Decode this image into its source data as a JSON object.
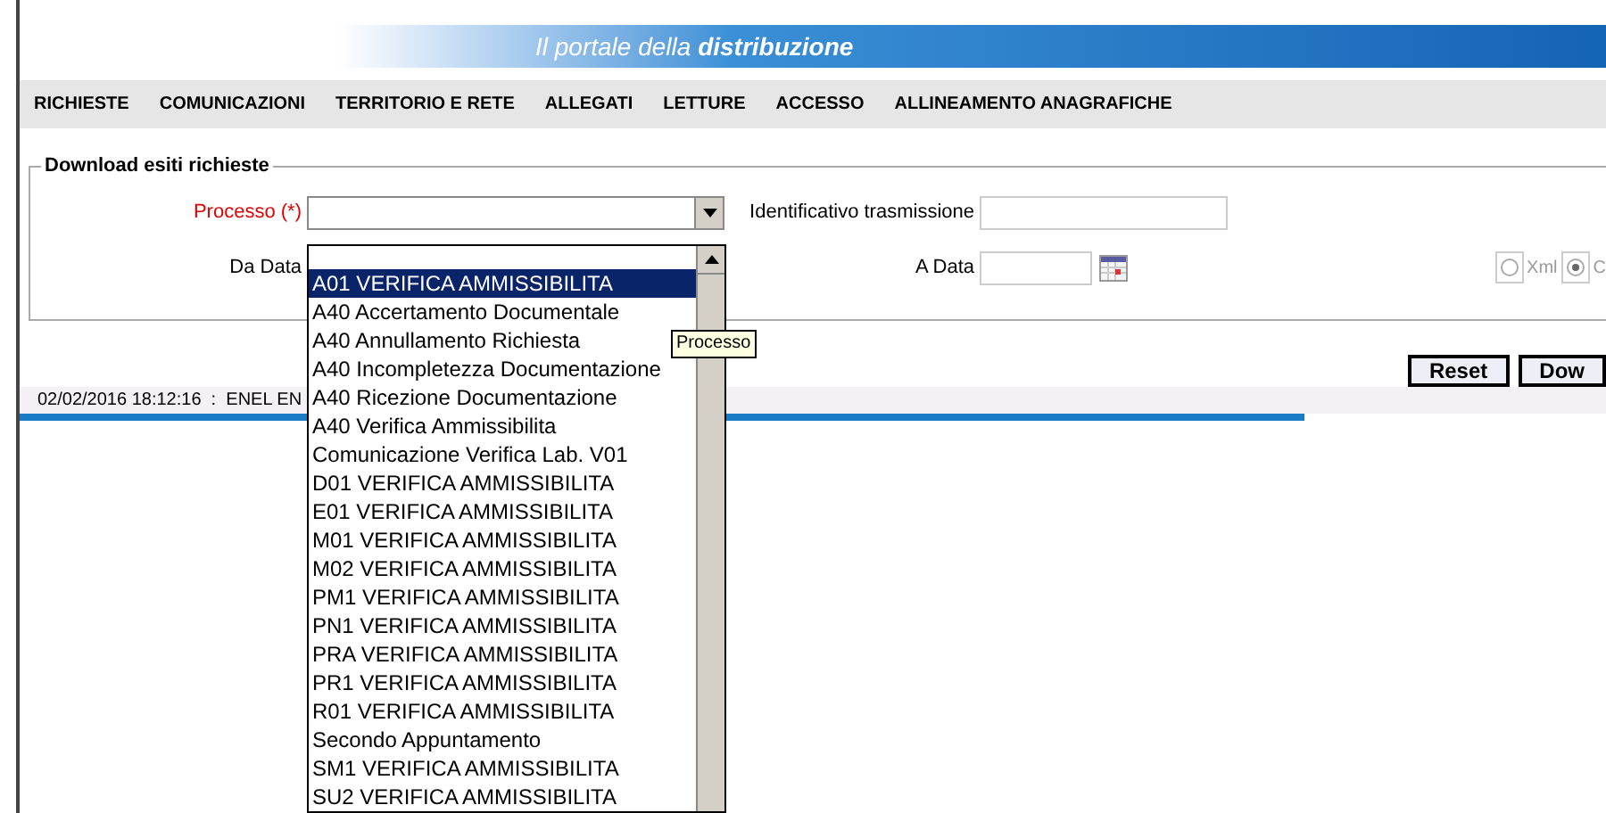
{
  "banner": {
    "title": "Il portale della **distribuzione**"
  },
  "nav": [
    "RICHIESTE",
    "COMUNICAZIONI",
    "TERRITORIO E RETE",
    "ALLEGATI",
    "LETTURE",
    "ACCESSO",
    "ALLINEAMENTO ANAGRAFICHE"
  ],
  "form": {
    "legend": "Download esiti richieste",
    "processo": {
      "label": "Processo (*)",
      "required": true
    },
    "identificativo": {
      "label": "Identificativo trasmissione"
    },
    "da_data": {
      "label": "Da Data"
    },
    "a_data": {
      "label": "A Data"
    },
    "format": [
      {
        "label": "Xml",
        "selected": false
      },
      {
        "label": "C",
        "selected": true
      }
    ]
  },
  "buttons": [
    "Reset",
    "Dow"
  ],
  "status_bar": {
    "text": "02/02/2016 18:12:16  :  ENEL EN"
  },
  "tooltip": "Processo",
  "dropdown": {
    "options": [
      {
        "label": "A01 VERIFICA AMMISSIBILITA",
        "selected": true
      },
      {
        "label": "A40 Accertamento Documentale",
        "selected": false
      },
      {
        "label": "A40 Annullamento Richiesta",
        "selected": false
      },
      {
        "label": "A40 Incompletezza Documentazione",
        "selected": false
      },
      {
        "label": "A40 Ricezione Documentazione",
        "selected": false
      },
      {
        "label": "A40 Verifica Ammissibilita",
        "selected": false
      },
      {
        "label": "Comunicazione Verifica Lab. V01",
        "selected": false
      },
      {
        "label": "D01 VERIFICA AMMISSIBILITA",
        "selected": false
      },
      {
        "label": "E01 VERIFICA AMMISSIBILITA",
        "selected": false
      },
      {
        "label": "M01 VERIFICA AMMISSIBILITA",
        "selected": false
      },
      {
        "label": "M02 VERIFICA AMMISSIBILITA",
        "selected": false
      },
      {
        "label": "PM1 VERIFICA AMMISSIBILITA",
        "selected": false
      },
      {
        "label": "PN1 VERIFICA AMMISSIBILITA",
        "selected": false
      },
      {
        "label": "PRA VERIFICA AMMISSIBILITA",
        "selected": false
      },
      {
        "label": "PR1 VERIFICA AMMISSIBILITA",
        "selected": false
      },
      {
        "label": "R01 VERIFICA AMMISSIBILITA",
        "selected": false
      },
      {
        "label": "Secondo Appuntamento",
        "selected": false
      },
      {
        "label": "SM1 VERIFICA AMMISSIBILITA",
        "selected": false
      },
      {
        "label": "SU2 VERIFICA AMMISSIBILITA",
        "selected": false
      }
    ]
  }
}
